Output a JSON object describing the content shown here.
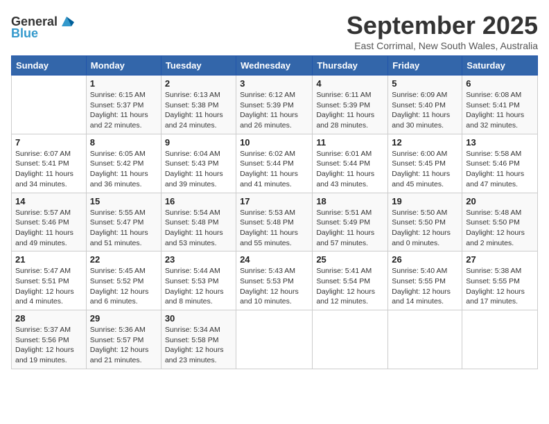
{
  "logo": {
    "general": "General",
    "blue": "Blue"
  },
  "title": "September 2025",
  "subtitle": "East Corrimal, New South Wales, Australia",
  "days_of_week": [
    "Sunday",
    "Monday",
    "Tuesday",
    "Wednesday",
    "Thursday",
    "Friday",
    "Saturday"
  ],
  "weeks": [
    [
      {
        "day": "",
        "sunrise": "",
        "sunset": "",
        "daylight": ""
      },
      {
        "day": "1",
        "sunrise": "Sunrise: 6:15 AM",
        "sunset": "Sunset: 5:37 PM",
        "daylight": "Daylight: 11 hours and 22 minutes."
      },
      {
        "day": "2",
        "sunrise": "Sunrise: 6:13 AM",
        "sunset": "Sunset: 5:38 PM",
        "daylight": "Daylight: 11 hours and 24 minutes."
      },
      {
        "day": "3",
        "sunrise": "Sunrise: 6:12 AM",
        "sunset": "Sunset: 5:39 PM",
        "daylight": "Daylight: 11 hours and 26 minutes."
      },
      {
        "day": "4",
        "sunrise": "Sunrise: 6:11 AM",
        "sunset": "Sunset: 5:39 PM",
        "daylight": "Daylight: 11 hours and 28 minutes."
      },
      {
        "day": "5",
        "sunrise": "Sunrise: 6:09 AM",
        "sunset": "Sunset: 5:40 PM",
        "daylight": "Daylight: 11 hours and 30 minutes."
      },
      {
        "day": "6",
        "sunrise": "Sunrise: 6:08 AM",
        "sunset": "Sunset: 5:41 PM",
        "daylight": "Daylight: 11 hours and 32 minutes."
      }
    ],
    [
      {
        "day": "7",
        "sunrise": "Sunrise: 6:07 AM",
        "sunset": "Sunset: 5:41 PM",
        "daylight": "Daylight: 11 hours and 34 minutes."
      },
      {
        "day": "8",
        "sunrise": "Sunrise: 6:05 AM",
        "sunset": "Sunset: 5:42 PM",
        "daylight": "Daylight: 11 hours and 36 minutes."
      },
      {
        "day": "9",
        "sunrise": "Sunrise: 6:04 AM",
        "sunset": "Sunset: 5:43 PM",
        "daylight": "Daylight: 11 hours and 39 minutes."
      },
      {
        "day": "10",
        "sunrise": "Sunrise: 6:02 AM",
        "sunset": "Sunset: 5:44 PM",
        "daylight": "Daylight: 11 hours and 41 minutes."
      },
      {
        "day": "11",
        "sunrise": "Sunrise: 6:01 AM",
        "sunset": "Sunset: 5:44 PM",
        "daylight": "Daylight: 11 hours and 43 minutes."
      },
      {
        "day": "12",
        "sunrise": "Sunrise: 6:00 AM",
        "sunset": "Sunset: 5:45 PM",
        "daylight": "Daylight: 11 hours and 45 minutes."
      },
      {
        "day": "13",
        "sunrise": "Sunrise: 5:58 AM",
        "sunset": "Sunset: 5:46 PM",
        "daylight": "Daylight: 11 hours and 47 minutes."
      }
    ],
    [
      {
        "day": "14",
        "sunrise": "Sunrise: 5:57 AM",
        "sunset": "Sunset: 5:46 PM",
        "daylight": "Daylight: 11 hours and 49 minutes."
      },
      {
        "day": "15",
        "sunrise": "Sunrise: 5:55 AM",
        "sunset": "Sunset: 5:47 PM",
        "daylight": "Daylight: 11 hours and 51 minutes."
      },
      {
        "day": "16",
        "sunrise": "Sunrise: 5:54 AM",
        "sunset": "Sunset: 5:48 PM",
        "daylight": "Daylight: 11 hours and 53 minutes."
      },
      {
        "day": "17",
        "sunrise": "Sunrise: 5:53 AM",
        "sunset": "Sunset: 5:48 PM",
        "daylight": "Daylight: 11 hours and 55 minutes."
      },
      {
        "day": "18",
        "sunrise": "Sunrise: 5:51 AM",
        "sunset": "Sunset: 5:49 PM",
        "daylight": "Daylight: 11 hours and 57 minutes."
      },
      {
        "day": "19",
        "sunrise": "Sunrise: 5:50 AM",
        "sunset": "Sunset: 5:50 PM",
        "daylight": "Daylight: 12 hours and 0 minutes."
      },
      {
        "day": "20",
        "sunrise": "Sunrise: 5:48 AM",
        "sunset": "Sunset: 5:50 PM",
        "daylight": "Daylight: 12 hours and 2 minutes."
      }
    ],
    [
      {
        "day": "21",
        "sunrise": "Sunrise: 5:47 AM",
        "sunset": "Sunset: 5:51 PM",
        "daylight": "Daylight: 12 hours and 4 minutes."
      },
      {
        "day": "22",
        "sunrise": "Sunrise: 5:45 AM",
        "sunset": "Sunset: 5:52 PM",
        "daylight": "Daylight: 12 hours and 6 minutes."
      },
      {
        "day": "23",
        "sunrise": "Sunrise: 5:44 AM",
        "sunset": "Sunset: 5:53 PM",
        "daylight": "Daylight: 12 hours and 8 minutes."
      },
      {
        "day": "24",
        "sunrise": "Sunrise: 5:43 AM",
        "sunset": "Sunset: 5:53 PM",
        "daylight": "Daylight: 12 hours and 10 minutes."
      },
      {
        "day": "25",
        "sunrise": "Sunrise: 5:41 AM",
        "sunset": "Sunset: 5:54 PM",
        "daylight": "Daylight: 12 hours and 12 minutes."
      },
      {
        "day": "26",
        "sunrise": "Sunrise: 5:40 AM",
        "sunset": "Sunset: 5:55 PM",
        "daylight": "Daylight: 12 hours and 14 minutes."
      },
      {
        "day": "27",
        "sunrise": "Sunrise: 5:38 AM",
        "sunset": "Sunset: 5:55 PM",
        "daylight": "Daylight: 12 hours and 17 minutes."
      }
    ],
    [
      {
        "day": "28",
        "sunrise": "Sunrise: 5:37 AM",
        "sunset": "Sunset: 5:56 PM",
        "daylight": "Daylight: 12 hours and 19 minutes."
      },
      {
        "day": "29",
        "sunrise": "Sunrise: 5:36 AM",
        "sunset": "Sunset: 5:57 PM",
        "daylight": "Daylight: 12 hours and 21 minutes."
      },
      {
        "day": "30",
        "sunrise": "Sunrise: 5:34 AM",
        "sunset": "Sunset: 5:58 PM",
        "daylight": "Daylight: 12 hours and 23 minutes."
      },
      {
        "day": "",
        "sunrise": "",
        "sunset": "",
        "daylight": ""
      },
      {
        "day": "",
        "sunrise": "",
        "sunset": "",
        "daylight": ""
      },
      {
        "day": "",
        "sunrise": "",
        "sunset": "",
        "daylight": ""
      },
      {
        "day": "",
        "sunrise": "",
        "sunset": "",
        "daylight": ""
      }
    ]
  ]
}
